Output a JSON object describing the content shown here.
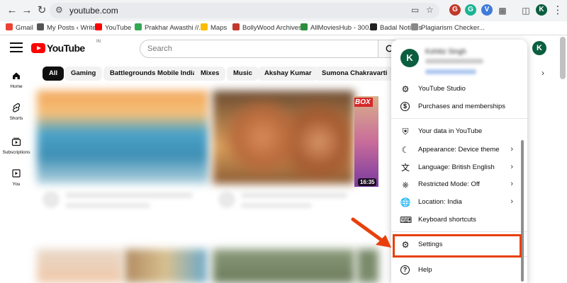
{
  "browser": {
    "url": "youtube.com",
    "bookmarks": [
      {
        "label": "Gmail",
        "color": "#ea4335"
      },
      {
        "label": "My Posts ‹ Write",
        "color": "#555555"
      },
      {
        "label": "YouTube",
        "color": "#ff0000"
      },
      {
        "label": "Prakhar Awasthi //...",
        "color": "#34a853"
      },
      {
        "label": "Maps",
        "color": "#fbbc04"
      },
      {
        "label": "BollyWood Archives...",
        "color": "#c0392b"
      },
      {
        "label": "AllMoviesHub - 300...",
        "color": "#2a8f3a"
      },
      {
        "label": "Badal Notions",
        "color": "#222222"
      },
      {
        "label": "Plagiarism Checker...",
        "color": "#888888"
      }
    ],
    "profile_initial": "K"
  },
  "youtube": {
    "logo_text": "YouTube",
    "logo_country": "IN",
    "search_placeholder": "Search",
    "avatar_initial": "K",
    "guide": [
      {
        "label": "Home",
        "icon": "home-icon"
      },
      {
        "label": "Shorts",
        "icon": "shorts-icon"
      },
      {
        "label": "Subscriptions",
        "icon": "subscriptions-icon"
      },
      {
        "label": "You",
        "icon": "you-icon"
      }
    ],
    "chips": [
      "All",
      "Gaming",
      "Battlegrounds Mobile India",
      "Mixes",
      "Music",
      "Akshay Kumar",
      "Sumona Chakravarti"
    ],
    "thumb_overlay_text": "BOX",
    "duration": "16:35"
  },
  "menu": {
    "avatar_initial": "K",
    "user_name": "Kshitiz Singh",
    "items": [
      {
        "label": "YouTube Studio",
        "icon": "studio-icon"
      },
      {
        "label": "Purchases and memberships",
        "icon": "dollar-icon"
      },
      {
        "label": "Your data in YouTube",
        "icon": "shield-person-icon"
      },
      {
        "label": "Appearance: Device theme",
        "icon": "moon-icon",
        "chevron": true
      },
      {
        "label": "Language: British English",
        "icon": "translate-icon",
        "chevron": true
      },
      {
        "label": "Restricted Mode: Off",
        "icon": "restricted-icon",
        "chevron": true
      },
      {
        "label": "Location: India",
        "icon": "globe-icon",
        "chevron": true
      },
      {
        "label": "Keyboard shortcuts",
        "icon": "keyboard-icon"
      },
      {
        "label": "Settings",
        "icon": "gear-icon"
      },
      {
        "label": "Help",
        "icon": "help-icon"
      }
    ]
  },
  "colors": {
    "highlight": "#e8400c",
    "youtube_red": "#ff0000",
    "avatar_green": "#0b5e3f"
  }
}
